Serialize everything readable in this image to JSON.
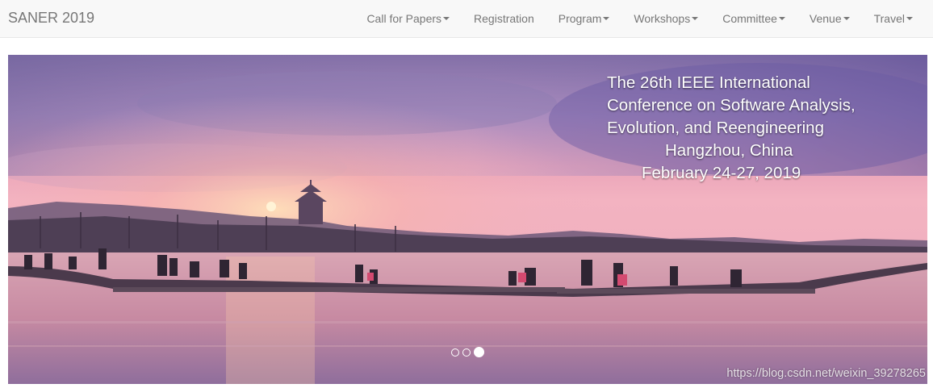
{
  "navbar": {
    "brand": "SANER 2019",
    "items": [
      {
        "label": "Call for Papers",
        "dropdown": true
      },
      {
        "label": "Registration",
        "dropdown": false
      },
      {
        "label": "Program",
        "dropdown": true
      },
      {
        "label": "Workshops",
        "dropdown": true
      },
      {
        "label": "Committee",
        "dropdown": true
      },
      {
        "label": "Venue",
        "dropdown": true
      },
      {
        "label": "Travel",
        "dropdown": true
      }
    ]
  },
  "carousel": {
    "caption": {
      "line1": "The 26th IEEE International",
      "line2": "Conference on Software Analysis,",
      "line3": "Evolution, and Reengineering",
      "line4": "Hangzhou, China",
      "line5": "February 24-27, 2019"
    },
    "slide_count": 3,
    "active_slide": 3,
    "watermark": "https://blog.csdn.net/weixin_39278265"
  },
  "colors": {
    "navbar_bg": "#f8f8f8",
    "nav_text": "#777777",
    "sky_top": "#6f6aa8",
    "sky_glow": "#f2a3b6",
    "water": "#c98ba4"
  }
}
